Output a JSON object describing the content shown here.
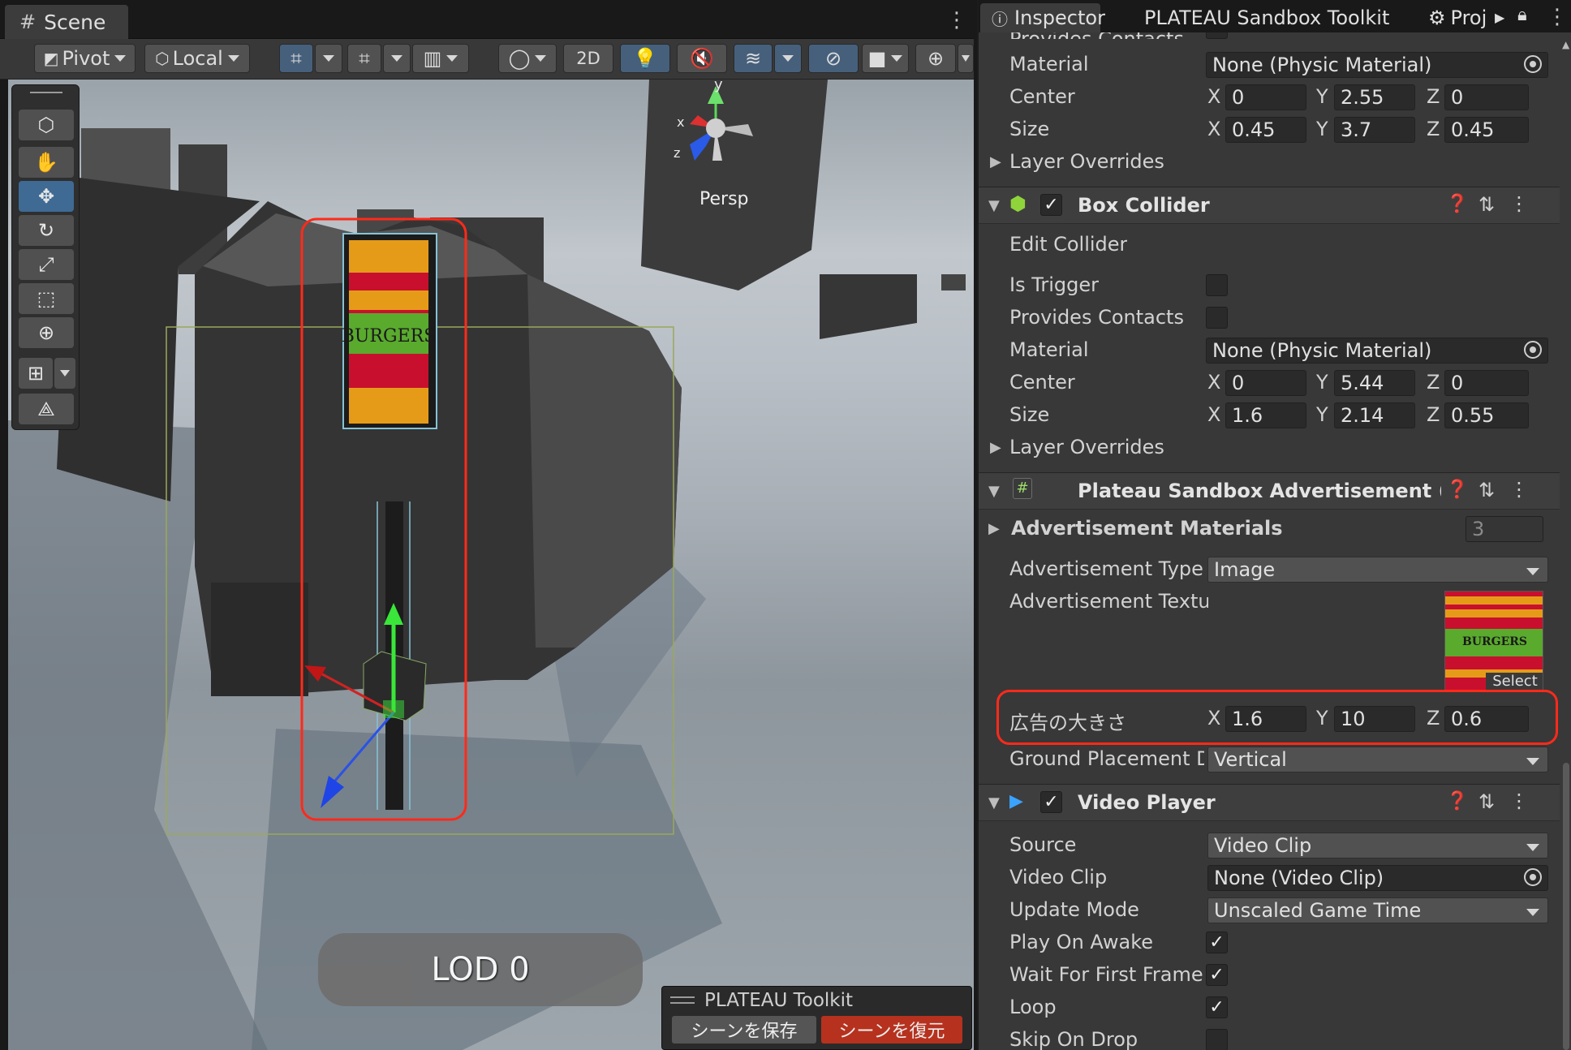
{
  "scene": {
    "tab_label": "Scene",
    "toolbar": {
      "pivot_label": "Pivot",
      "local_label": "Local",
      "mode_2d_label": "2D"
    },
    "gizmo": {
      "x_label": "x",
      "y_label": "y",
      "z_label": "z",
      "projection_label": "Persp"
    },
    "billboard_text": "BURGERS",
    "lod_label": "LOD 0",
    "toolkit_overlay": {
      "title": "PLATEAU Toolkit",
      "save_button": "シーンを保存",
      "restore_button": "シーンを復元"
    }
  },
  "inspector": {
    "tabs": [
      {
        "label": "Inspector",
        "icon": "info-icon"
      },
      {
        "label": "PLATEAU Sandbox Toolkit"
      },
      {
        "label": "Proj",
        "icon": "gear-icon"
      }
    ],
    "capsule_collider": {
      "clipped_label": "Provides Contacts",
      "material_label": "Material",
      "material_value": "None (Physic Material)",
      "center_label": "Center",
      "center": {
        "x": "0",
        "y": "2.55",
        "z": "0"
      },
      "size_label": "Size",
      "size": {
        "x": "0.45",
        "y": "3.7",
        "z": "0.45"
      },
      "layer_overrides_label": "Layer Overrides"
    },
    "box_collider": {
      "title": "Box Collider",
      "edit_collider_label": "Edit Collider",
      "is_trigger_label": "Is Trigger",
      "provides_contacts_label": "Provides Contacts",
      "material_label": "Material",
      "material_value": "None (Physic Material)",
      "center_label": "Center",
      "center": {
        "x": "0",
        "y": "5.44",
        "z": "0"
      },
      "size_label": "Size",
      "size": {
        "x": "1.6",
        "y": "2.14",
        "z": "0.55"
      },
      "layer_overrides_label": "Layer Overrides"
    },
    "advertisement": {
      "title": "Plateau Sandbox Advertisement (Scrip",
      "materials_label": "Advertisement Materials",
      "materials_count": "3",
      "type_label": "Advertisement Type",
      "type_value": "Image",
      "texture_label": "Advertisement Textur",
      "texture_select_label": "Select",
      "size_label": "広告の大きさ",
      "size": {
        "x": "1.6",
        "y": "10",
        "z": "0.6"
      },
      "placement_label": "Ground Placement Di",
      "placement_value": "Vertical"
    },
    "video_player": {
      "title": "Video Player",
      "source_label": "Source",
      "source_value": "Video Clip",
      "clip_label": "Video Clip",
      "clip_value": "None (Video Clip)",
      "update_mode_label": "Update Mode",
      "update_mode_value": "Unscaled Game Time",
      "play_on_awake_label": "Play On Awake",
      "wait_first_frame_label": "Wait For First Frame",
      "loop_label": "Loop",
      "skip_on_drop_label": "Skip On Drop"
    },
    "axis_labels": {
      "x": "X",
      "y": "Y",
      "z": "Z"
    }
  },
  "colors": {
    "highlight": "#ff2a1a",
    "active_tool": "#3f6a94",
    "panel": "#383838"
  }
}
